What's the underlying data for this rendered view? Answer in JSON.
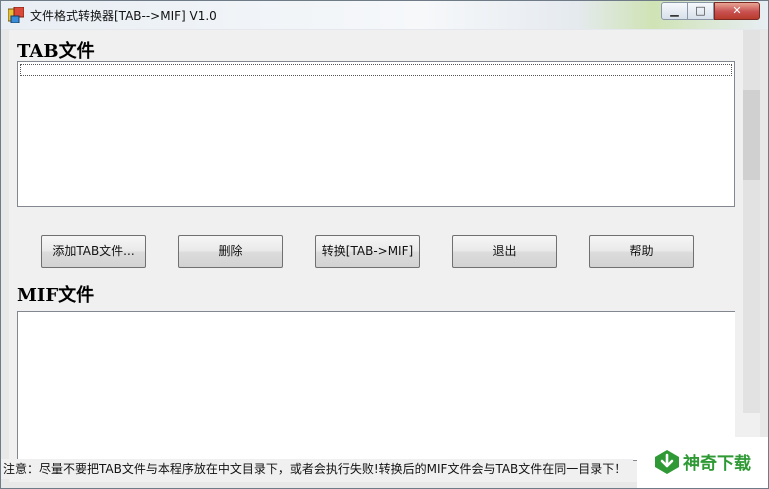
{
  "window": {
    "title": "文件格式转换器[TAB-->MIF] V1.0",
    "minimize_glyph": "▁",
    "maximize_glyph": "□",
    "close_glyph": "✕"
  },
  "tab_section": {
    "label": "TAB文件"
  },
  "buttons": {
    "add": "添加TAB文件...",
    "delete": "删除",
    "convert": "转换[TAB->MIF]",
    "exit": "退出",
    "help": "帮助"
  },
  "mif_section": {
    "label": "MIF文件"
  },
  "status": {
    "text": "注意：尽量不要把TAB文件与本程序放在中文目录下，或者会执行失败!转换后的MIF文件会与TAB文件在同一目录下！"
  },
  "watermark": {
    "text": "神奇下载"
  },
  "colors": {
    "watermark_green": "#2f9a35",
    "close_red": "#c75050"
  },
  "icons": {
    "app": "app-icon",
    "watermark": "download-logo-icon"
  }
}
